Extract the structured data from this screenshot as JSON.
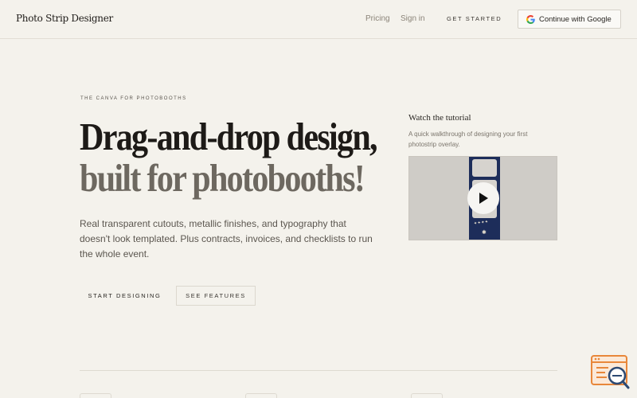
{
  "header": {
    "logo": "Photo Strip Designer",
    "nav": {
      "pricing": "Pricing",
      "sign_in": "Sign in",
      "get_started": "GET STARTED"
    },
    "google_button": "Continue with Google"
  },
  "hero": {
    "eyebrow": "THE CANVA FOR PHOTOBOOTHS",
    "headline_line1": "Drag-and-drop design,",
    "headline_line2": "built for photobooths!",
    "subtext": "Real transparent cutouts, metallic finishes, and typography that doesn't look templated. Plus contracts, invoices, and checklists to run the whole event.",
    "primary_cta": "START DESIGNING",
    "secondary_cta": "SEE FEATURES"
  },
  "tutorial": {
    "title": "Watch the tutorial",
    "description": "A quick walkthrough of designing your first photostrip overlay."
  },
  "colors": {
    "background": "#f4f2ec",
    "strip_navy": "#1d2d5a",
    "accent_orange": "#e8873a"
  },
  "icons": [
    "google-icon",
    "play-icon",
    "support-chat-icon"
  ]
}
